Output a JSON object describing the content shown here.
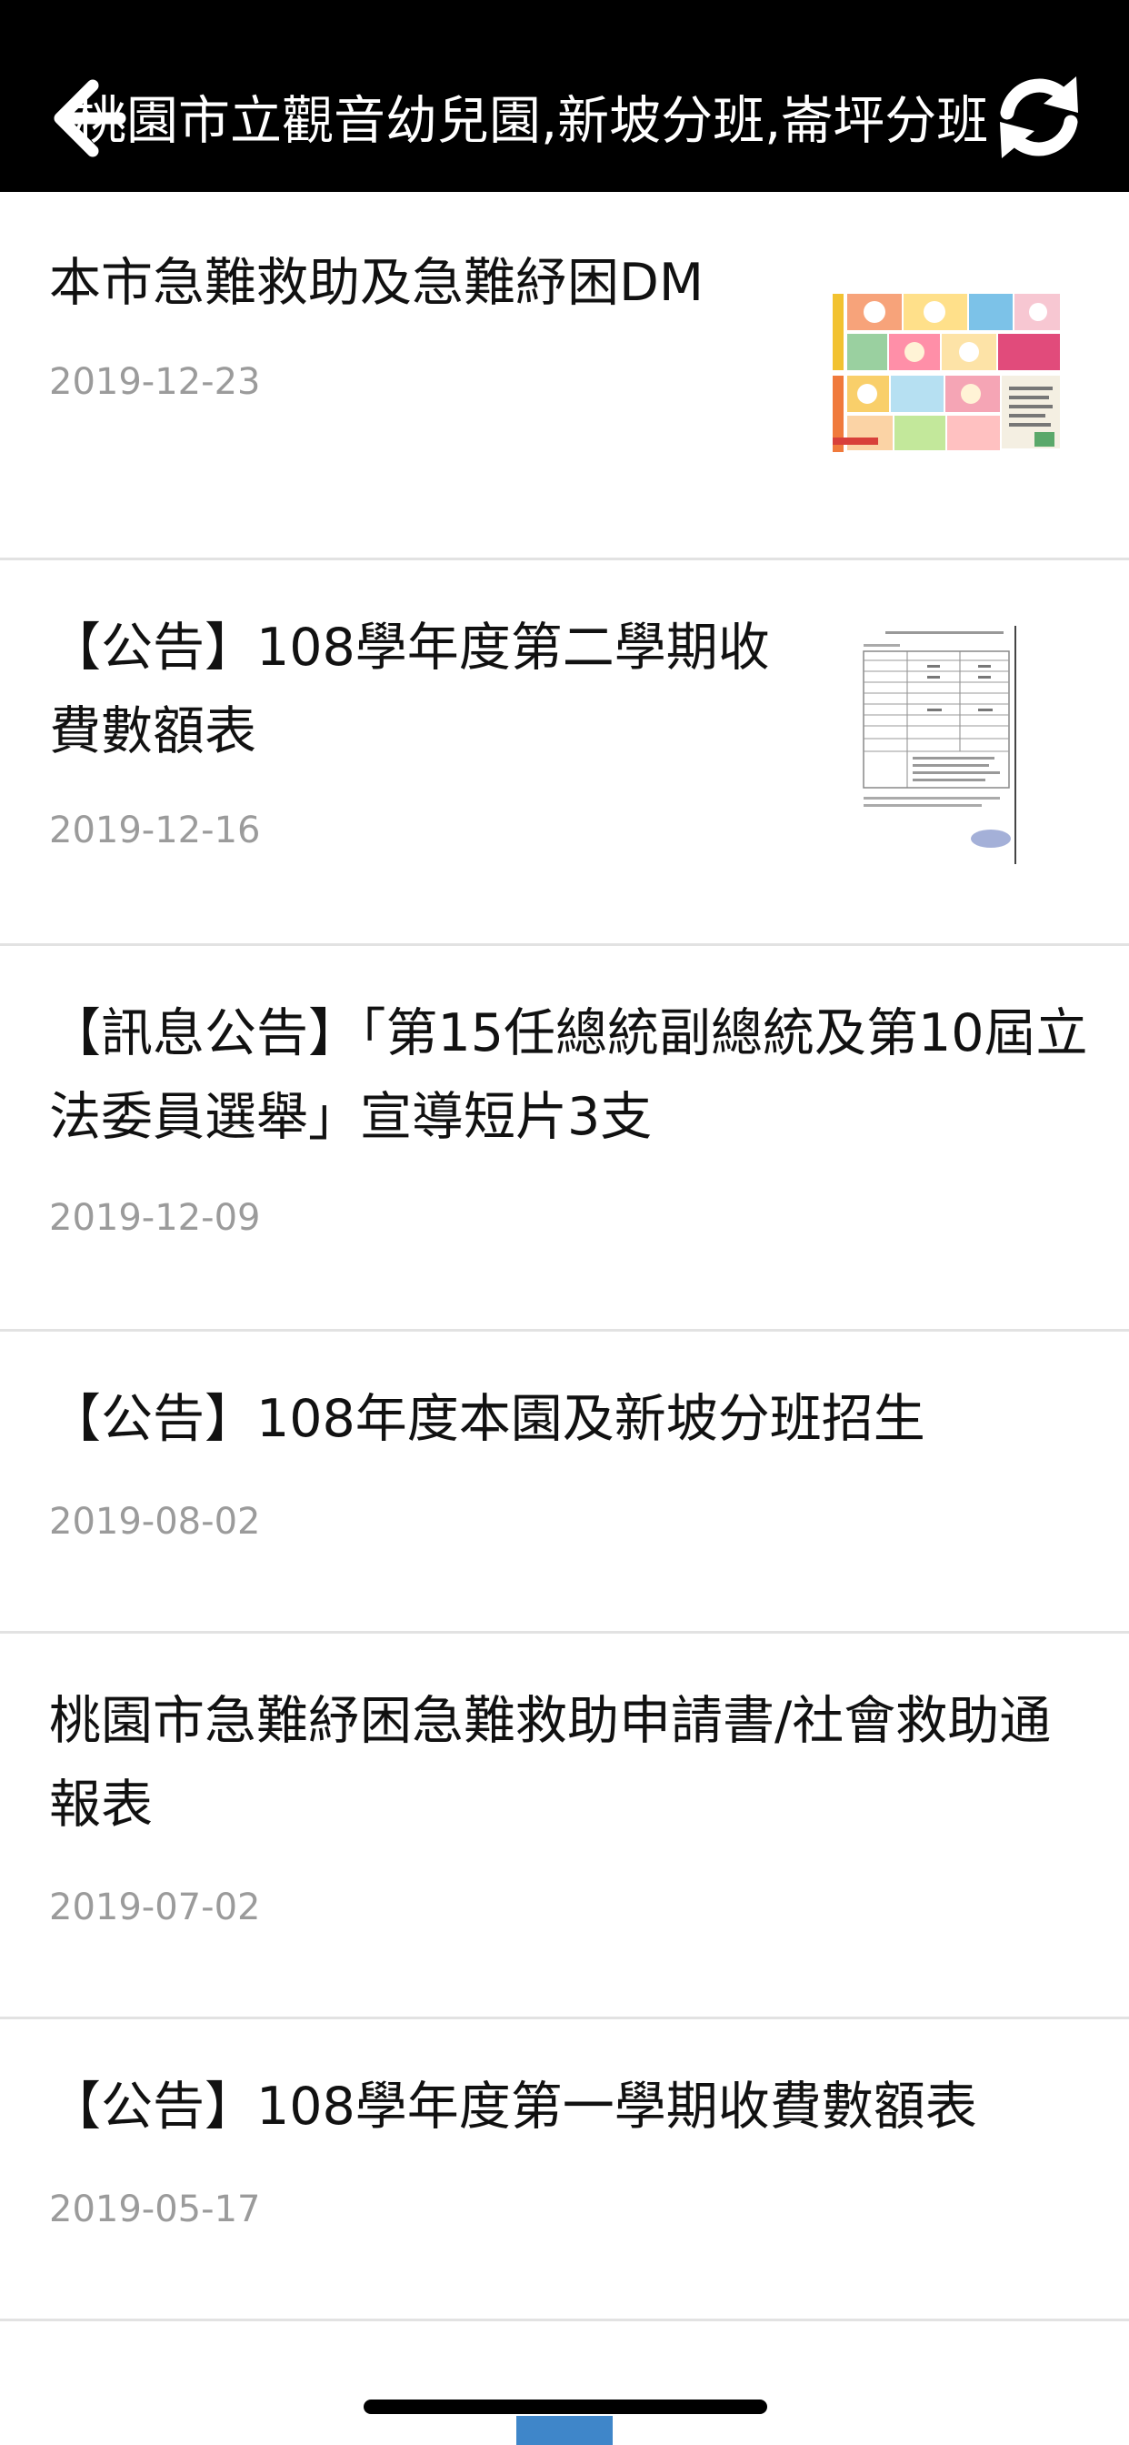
{
  "header": {
    "title": "桃園市立觀音幼兒園,新坡分班,崙坪分班",
    "back_icon": "arrow-left-icon",
    "refresh_icon": "refresh-icon"
  },
  "news": [
    {
      "title": "本市急難救助及急難紓困DM",
      "date": "2019-12-23",
      "thumbnail": "comic-flyer-thumbnail"
    },
    {
      "title": "【公告】108學年度第二學期收費數額表",
      "date": "2019-12-16",
      "thumbnail": "fee-table-document-thumbnail"
    },
    {
      "title": "【訊息公告】「第15任總統副總統及第10屆立法委員選舉」宣導短片3支",
      "date": "2019-12-09"
    },
    {
      "title": "【公告】108年度本園及新坡分班招生",
      "date": "2019-08-02"
    },
    {
      "title": "桃園市急難紓困急難救助申請書/社會救助通報表",
      "date": "2019-07-02"
    },
    {
      "title": "【公告】108學年度第一學期收費數額表",
      "date": "2019-05-17"
    }
  ],
  "colors": {
    "header_bg": "#000000",
    "header_text": "#ffffff",
    "title_text": "#111111",
    "date_text": "#9b9b9b",
    "divider": "#e2e2e2",
    "accent": "#3f86c9"
  }
}
